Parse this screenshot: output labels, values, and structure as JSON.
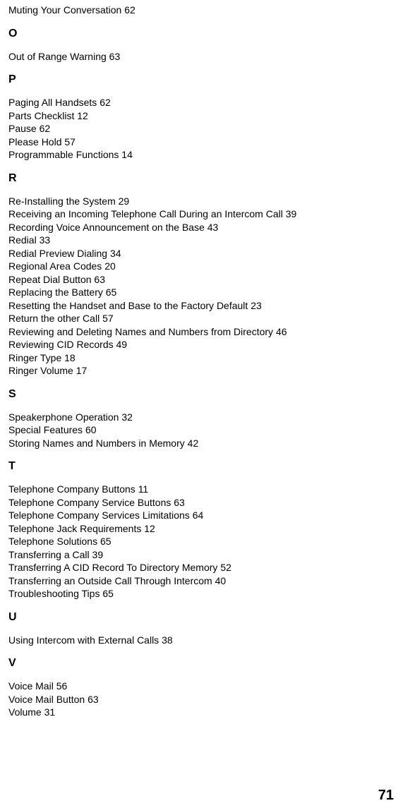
{
  "page_number": "71",
  "sections": [
    {
      "letter": null,
      "entries": [
        {
          "text": "Muting Your Conversation",
          "page": "62"
        }
      ]
    },
    {
      "letter": "O",
      "entries": [
        {
          "text": "Out of Range Warning",
          "page": "63"
        }
      ]
    },
    {
      "letter": "P",
      "entries": [
        {
          "text": "Paging All Handsets",
          "page": "62"
        },
        {
          "text": "Parts Checklist",
          "page": "12"
        },
        {
          "text": "Pause",
          "page": "62"
        },
        {
          "text": "Please Hold",
          "page": "57"
        },
        {
          "text": "Programmable Functions",
          "page": "14"
        }
      ]
    },
    {
      "letter": "R",
      "entries": [
        {
          "text": "Re-Installing the System",
          "page": "29"
        },
        {
          "text": "Receiving an Incoming Telephone Call During an Intercom Call",
          "page": "39"
        },
        {
          "text": "Recording Voice Announcement on the Base",
          "page": "43"
        },
        {
          "text": "Redial",
          "page": "33"
        },
        {
          "text": "Redial  Preview Dialing",
          "page": "34"
        },
        {
          "text": "Regional Area Codes",
          "page": "20"
        },
        {
          "text": "Repeat Dial Button",
          "page": "63"
        },
        {
          "text": "Replacing the Battery",
          "page": "65"
        },
        {
          "text": "Resetting the Handset and Base to the Factory Default",
          "page": "23"
        },
        {
          "text": "Return the other Call",
          "page": "57"
        },
        {
          "text": "Reviewing and Deleting Names and Numbers from Directory",
          "page": "46"
        },
        {
          "text": "Reviewing CID Records",
          "page": "49"
        },
        {
          "text": "Ringer Type",
          "page": "18"
        },
        {
          "text": "Ringer Volume",
          "page": "17"
        }
      ]
    },
    {
      "letter": "S",
      "entries": [
        {
          "text": "Speakerphone Operation",
          "page": "32"
        },
        {
          "text": "Special Features",
          "page": "60"
        },
        {
          "text": "Storing Names and Numbers in Memory",
          "page": "42"
        }
      ]
    },
    {
      "letter": "T",
      "entries": [
        {
          "text": "Telephone Company Buttons",
          "page": "11"
        },
        {
          "text": "Telephone Company Service Buttons",
          "page": "63"
        },
        {
          "text": "Telephone Company Services Limitations",
          "page": "64"
        },
        {
          "text": "Telephone Jack Requirements",
          "page": "12"
        },
        {
          "text": "Telephone Solutions",
          "page": "65"
        },
        {
          "text": "Transferring a Call",
          "page": "39"
        },
        {
          "text": "Transferring A CID Record To Directory Memory",
          "page": "52"
        },
        {
          "text": "Transferring an Outside Call Through Intercom",
          "page": "40"
        },
        {
          "text": "Troubleshooting Tips",
          "page": "65"
        }
      ]
    },
    {
      "letter": "U",
      "entries": [
        {
          "text": "Using Intercom with External Calls",
          "page": "38"
        }
      ]
    },
    {
      "letter": "V",
      "entries": [
        {
          "text": "Voice Mail",
          "page": "56"
        },
        {
          "text": "Voice Mail Button",
          "page": "63"
        },
        {
          "text": "Volume",
          "page": "31"
        }
      ]
    }
  ]
}
